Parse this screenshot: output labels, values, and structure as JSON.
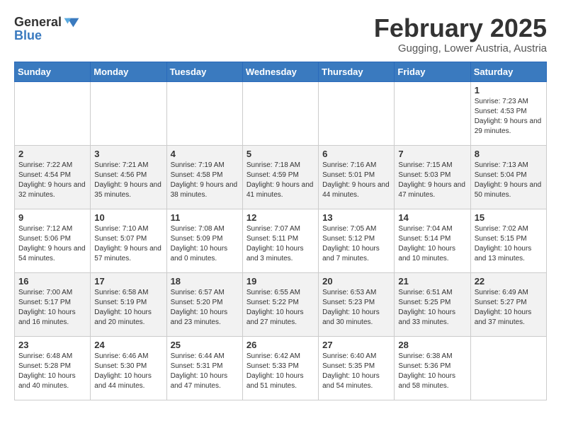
{
  "logo": {
    "line1": "General",
    "line2": "Blue"
  },
  "title": "February 2025",
  "location": "Gugging, Lower Austria, Austria",
  "days_header": [
    "Sunday",
    "Monday",
    "Tuesday",
    "Wednesday",
    "Thursday",
    "Friday",
    "Saturday"
  ],
  "weeks": [
    [
      {
        "day": "",
        "info": ""
      },
      {
        "day": "",
        "info": ""
      },
      {
        "day": "",
        "info": ""
      },
      {
        "day": "",
        "info": ""
      },
      {
        "day": "",
        "info": ""
      },
      {
        "day": "",
        "info": ""
      },
      {
        "day": "1",
        "info": "Sunrise: 7:23 AM\nSunset: 4:53 PM\nDaylight: 9 hours and 29 minutes."
      }
    ],
    [
      {
        "day": "2",
        "info": "Sunrise: 7:22 AM\nSunset: 4:54 PM\nDaylight: 9 hours and 32 minutes."
      },
      {
        "day": "3",
        "info": "Sunrise: 7:21 AM\nSunset: 4:56 PM\nDaylight: 9 hours and 35 minutes."
      },
      {
        "day": "4",
        "info": "Sunrise: 7:19 AM\nSunset: 4:58 PM\nDaylight: 9 hours and 38 minutes."
      },
      {
        "day": "5",
        "info": "Sunrise: 7:18 AM\nSunset: 4:59 PM\nDaylight: 9 hours and 41 minutes."
      },
      {
        "day": "6",
        "info": "Sunrise: 7:16 AM\nSunset: 5:01 PM\nDaylight: 9 hours and 44 minutes."
      },
      {
        "day": "7",
        "info": "Sunrise: 7:15 AM\nSunset: 5:03 PM\nDaylight: 9 hours and 47 minutes."
      },
      {
        "day": "8",
        "info": "Sunrise: 7:13 AM\nSunset: 5:04 PM\nDaylight: 9 hours and 50 minutes."
      }
    ],
    [
      {
        "day": "9",
        "info": "Sunrise: 7:12 AM\nSunset: 5:06 PM\nDaylight: 9 hours and 54 minutes."
      },
      {
        "day": "10",
        "info": "Sunrise: 7:10 AM\nSunset: 5:07 PM\nDaylight: 9 hours and 57 minutes."
      },
      {
        "day": "11",
        "info": "Sunrise: 7:08 AM\nSunset: 5:09 PM\nDaylight: 10 hours and 0 minutes."
      },
      {
        "day": "12",
        "info": "Sunrise: 7:07 AM\nSunset: 5:11 PM\nDaylight: 10 hours and 3 minutes."
      },
      {
        "day": "13",
        "info": "Sunrise: 7:05 AM\nSunset: 5:12 PM\nDaylight: 10 hours and 7 minutes."
      },
      {
        "day": "14",
        "info": "Sunrise: 7:04 AM\nSunset: 5:14 PM\nDaylight: 10 hours and 10 minutes."
      },
      {
        "day": "15",
        "info": "Sunrise: 7:02 AM\nSunset: 5:15 PM\nDaylight: 10 hours and 13 minutes."
      }
    ],
    [
      {
        "day": "16",
        "info": "Sunrise: 7:00 AM\nSunset: 5:17 PM\nDaylight: 10 hours and 16 minutes."
      },
      {
        "day": "17",
        "info": "Sunrise: 6:58 AM\nSunset: 5:19 PM\nDaylight: 10 hours and 20 minutes."
      },
      {
        "day": "18",
        "info": "Sunrise: 6:57 AM\nSunset: 5:20 PM\nDaylight: 10 hours and 23 minutes."
      },
      {
        "day": "19",
        "info": "Sunrise: 6:55 AM\nSunset: 5:22 PM\nDaylight: 10 hours and 27 minutes."
      },
      {
        "day": "20",
        "info": "Sunrise: 6:53 AM\nSunset: 5:23 PM\nDaylight: 10 hours and 30 minutes."
      },
      {
        "day": "21",
        "info": "Sunrise: 6:51 AM\nSunset: 5:25 PM\nDaylight: 10 hours and 33 minutes."
      },
      {
        "day": "22",
        "info": "Sunrise: 6:49 AM\nSunset: 5:27 PM\nDaylight: 10 hours and 37 minutes."
      }
    ],
    [
      {
        "day": "23",
        "info": "Sunrise: 6:48 AM\nSunset: 5:28 PM\nDaylight: 10 hours and 40 minutes."
      },
      {
        "day": "24",
        "info": "Sunrise: 6:46 AM\nSunset: 5:30 PM\nDaylight: 10 hours and 44 minutes."
      },
      {
        "day": "25",
        "info": "Sunrise: 6:44 AM\nSunset: 5:31 PM\nDaylight: 10 hours and 47 minutes."
      },
      {
        "day": "26",
        "info": "Sunrise: 6:42 AM\nSunset: 5:33 PM\nDaylight: 10 hours and 51 minutes."
      },
      {
        "day": "27",
        "info": "Sunrise: 6:40 AM\nSunset: 5:35 PM\nDaylight: 10 hours and 54 minutes."
      },
      {
        "day": "28",
        "info": "Sunrise: 6:38 AM\nSunset: 5:36 PM\nDaylight: 10 hours and 58 minutes."
      },
      {
        "day": "",
        "info": ""
      }
    ]
  ]
}
